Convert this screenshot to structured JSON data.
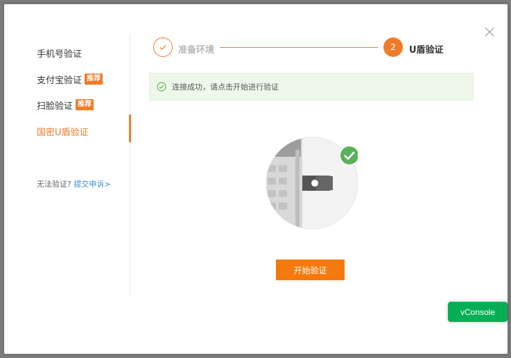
{
  "menu": {
    "items": [
      {
        "label": "手机号验证",
        "tag": ""
      },
      {
        "label": "支付宝验证",
        "tag": "推荐"
      },
      {
        "label": "扫脸验证",
        "tag": "推荐"
      },
      {
        "label": "国密U盾验证",
        "tag": "",
        "active": true
      }
    ],
    "help_text": "无法验证?",
    "help_link": "提交申诉>"
  },
  "steps": [
    {
      "number": "1",
      "label": "准备环境",
      "status": "done"
    },
    {
      "number": "2",
      "label": "U盾验证",
      "status": "current"
    }
  ],
  "banner": {
    "text": "连接成功，请点击开始进行验证"
  },
  "start_button": {
    "label": "开始验证"
  },
  "vconsole": {
    "label": "vConsole"
  },
  "colors": {
    "accent": "#f07b2a",
    "button": "#f47a0f",
    "success": "#5bb05a",
    "link": "#3d8fd1",
    "vconsole": "#06ae56"
  },
  "icons": {
    "close": "close-icon",
    "step_done": "check-icon",
    "banner": "success-check-icon"
  }
}
